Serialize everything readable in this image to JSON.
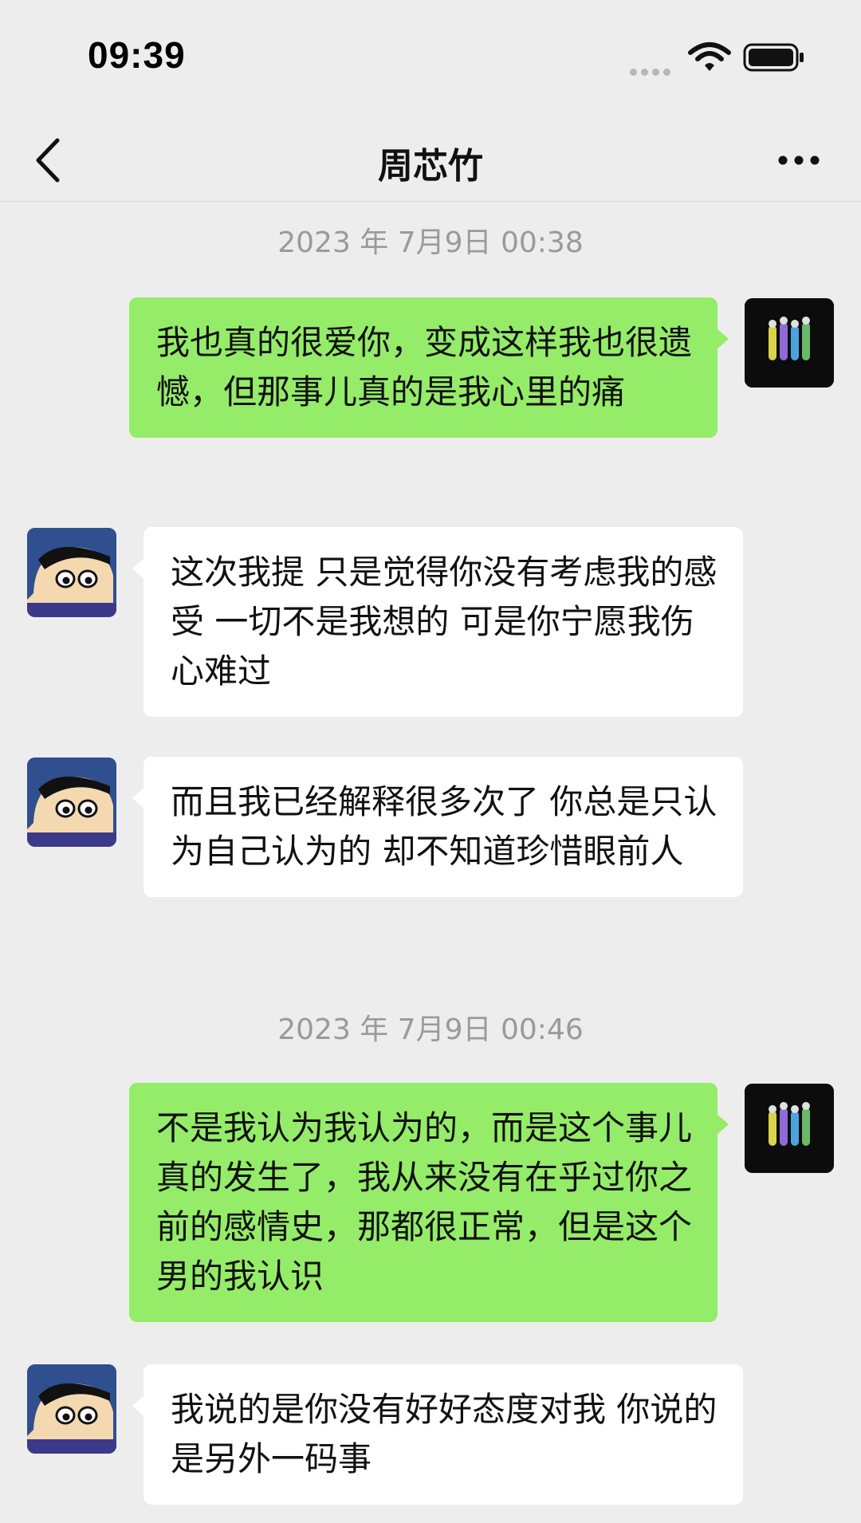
{
  "status_bar": {
    "time": "09:39",
    "icons": [
      "cellular-signal-icon",
      "wifi-icon",
      "battery-icon"
    ]
  },
  "nav": {
    "back_icon": "chevron-left-icon",
    "title": "周芯竹",
    "more_icon": "more-dots-icon"
  },
  "colors": {
    "background": "#ededed",
    "self_bubble": "#95ec69",
    "other_bubble": "#ffffff",
    "timestamp_text": "#9a9a9a"
  },
  "messages": [
    {
      "type": "timestamp",
      "text": "2023 年 7月9日 00:38"
    },
    {
      "type": "message",
      "sender": "self",
      "text": "我也真的很爱你，变成这样我也很遗憾，但那事儿真的是我心里的痛"
    },
    {
      "type": "message",
      "sender": "other",
      "text": "这次我提 只是觉得你没有考虑我的感受 一切不是我想的 可是你宁愿我伤心难过"
    },
    {
      "type": "message",
      "sender": "other",
      "text": "而且我已经解释很多次了 你总是只认为自己认为的 却不知道珍惜眼前人"
    },
    {
      "type": "timestamp",
      "text": "2023 年 7月9日 00:46"
    },
    {
      "type": "message",
      "sender": "self",
      "text": "不是我认为我认为的，而是这个事儿真的发生了，我从来没有在乎过你之前的感情史，那都很正常，但是这个男的我认识"
    },
    {
      "type": "message",
      "sender": "other",
      "text": "我说的是你没有好好态度对我 你说的是另外一码事"
    }
  ]
}
